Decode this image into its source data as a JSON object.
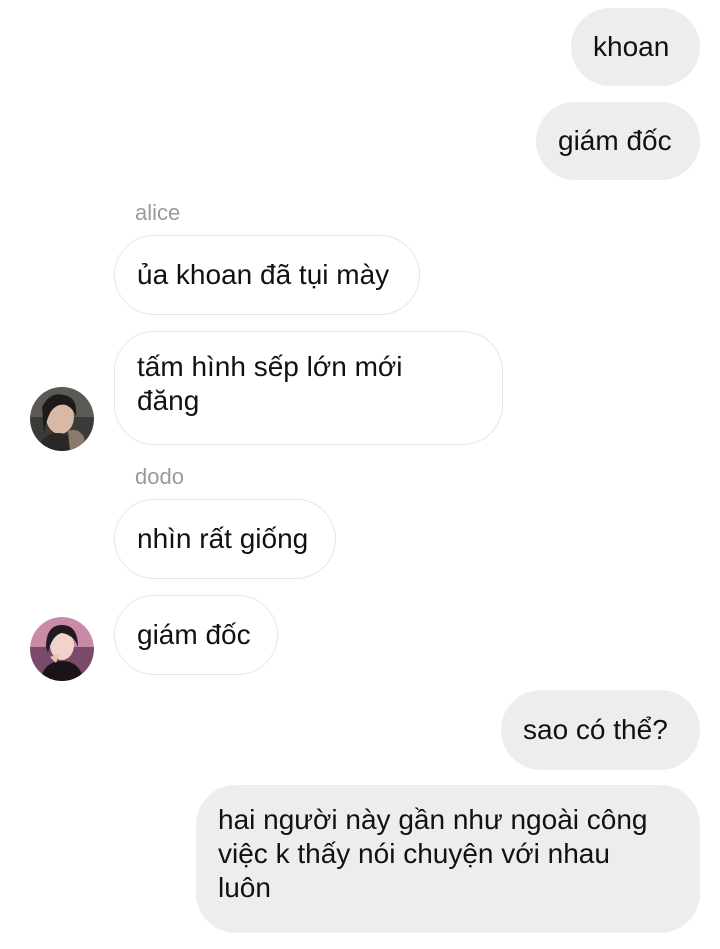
{
  "messages": [
    {
      "text": "khoan",
      "direction": "out"
    },
    {
      "text": "giám đốc",
      "direction": "out"
    },
    {
      "text": "ủa khoan đã tụi mày",
      "direction": "in",
      "sender": "alice"
    },
    {
      "text": "tấm hình sếp lớn mới đăng",
      "direction": "in",
      "sender": "alice"
    },
    {
      "text": "nhìn rất giống",
      "direction": "in",
      "sender": "dodo"
    },
    {
      "text": "giám đốc",
      "direction": "in",
      "sender": "dodo"
    },
    {
      "text": "sao có thể?",
      "direction": "out"
    },
    {
      "text": "hai người này gần như ngoài công việc k thấy nói chuyện với nhau luôn",
      "direction": "out"
    }
  ],
  "senders": {
    "alice": "alice",
    "dodo": "dodo"
  },
  "lines": {
    "m3": [
      "tấm hình sếp lớn mới",
      "đăng"
    ],
    "m7": [
      "hai người này gần như ngoài công",
      "việc k thấy nói chuyện với nhau",
      "luôn"
    ]
  },
  "colors": {
    "outgoing_bubble": "#ededed",
    "incoming_bubble": "#ffffff",
    "incoming_border": "#e6e6e6",
    "sender_name": "#9a9a9a"
  }
}
